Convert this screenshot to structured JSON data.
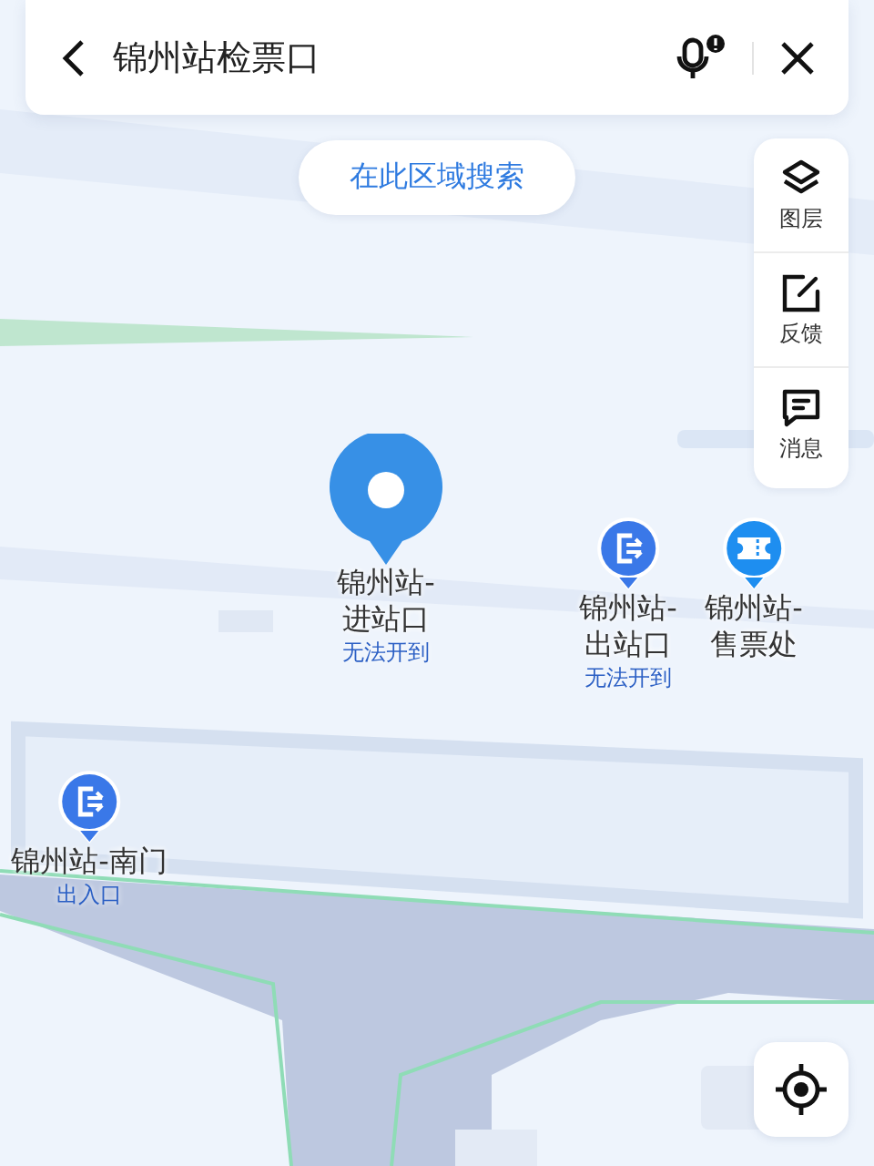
{
  "search": {
    "value": "锦州站检票口"
  },
  "area_search_button": "在此区域搜索",
  "side_tools": [
    {
      "kind": "layers",
      "label": "图层"
    },
    {
      "kind": "feedback",
      "label": "反馈"
    },
    {
      "kind": "message",
      "label": "消息"
    }
  ],
  "pois": [
    {
      "kind": "pin",
      "name_lines": [
        "锦州站-",
        "进站口"
      ],
      "note": "无法开到"
    },
    {
      "kind": "exit",
      "name_lines": [
        "锦州站-",
        "出站口"
      ],
      "note": "无法开到"
    },
    {
      "kind": "ticket",
      "name_lines": [
        "锦州站-",
        "售票处"
      ]
    },
    {
      "kind": "exit",
      "name_lines": [
        "锦州站-南门"
      ],
      "note": "出入口"
    }
  ]
}
